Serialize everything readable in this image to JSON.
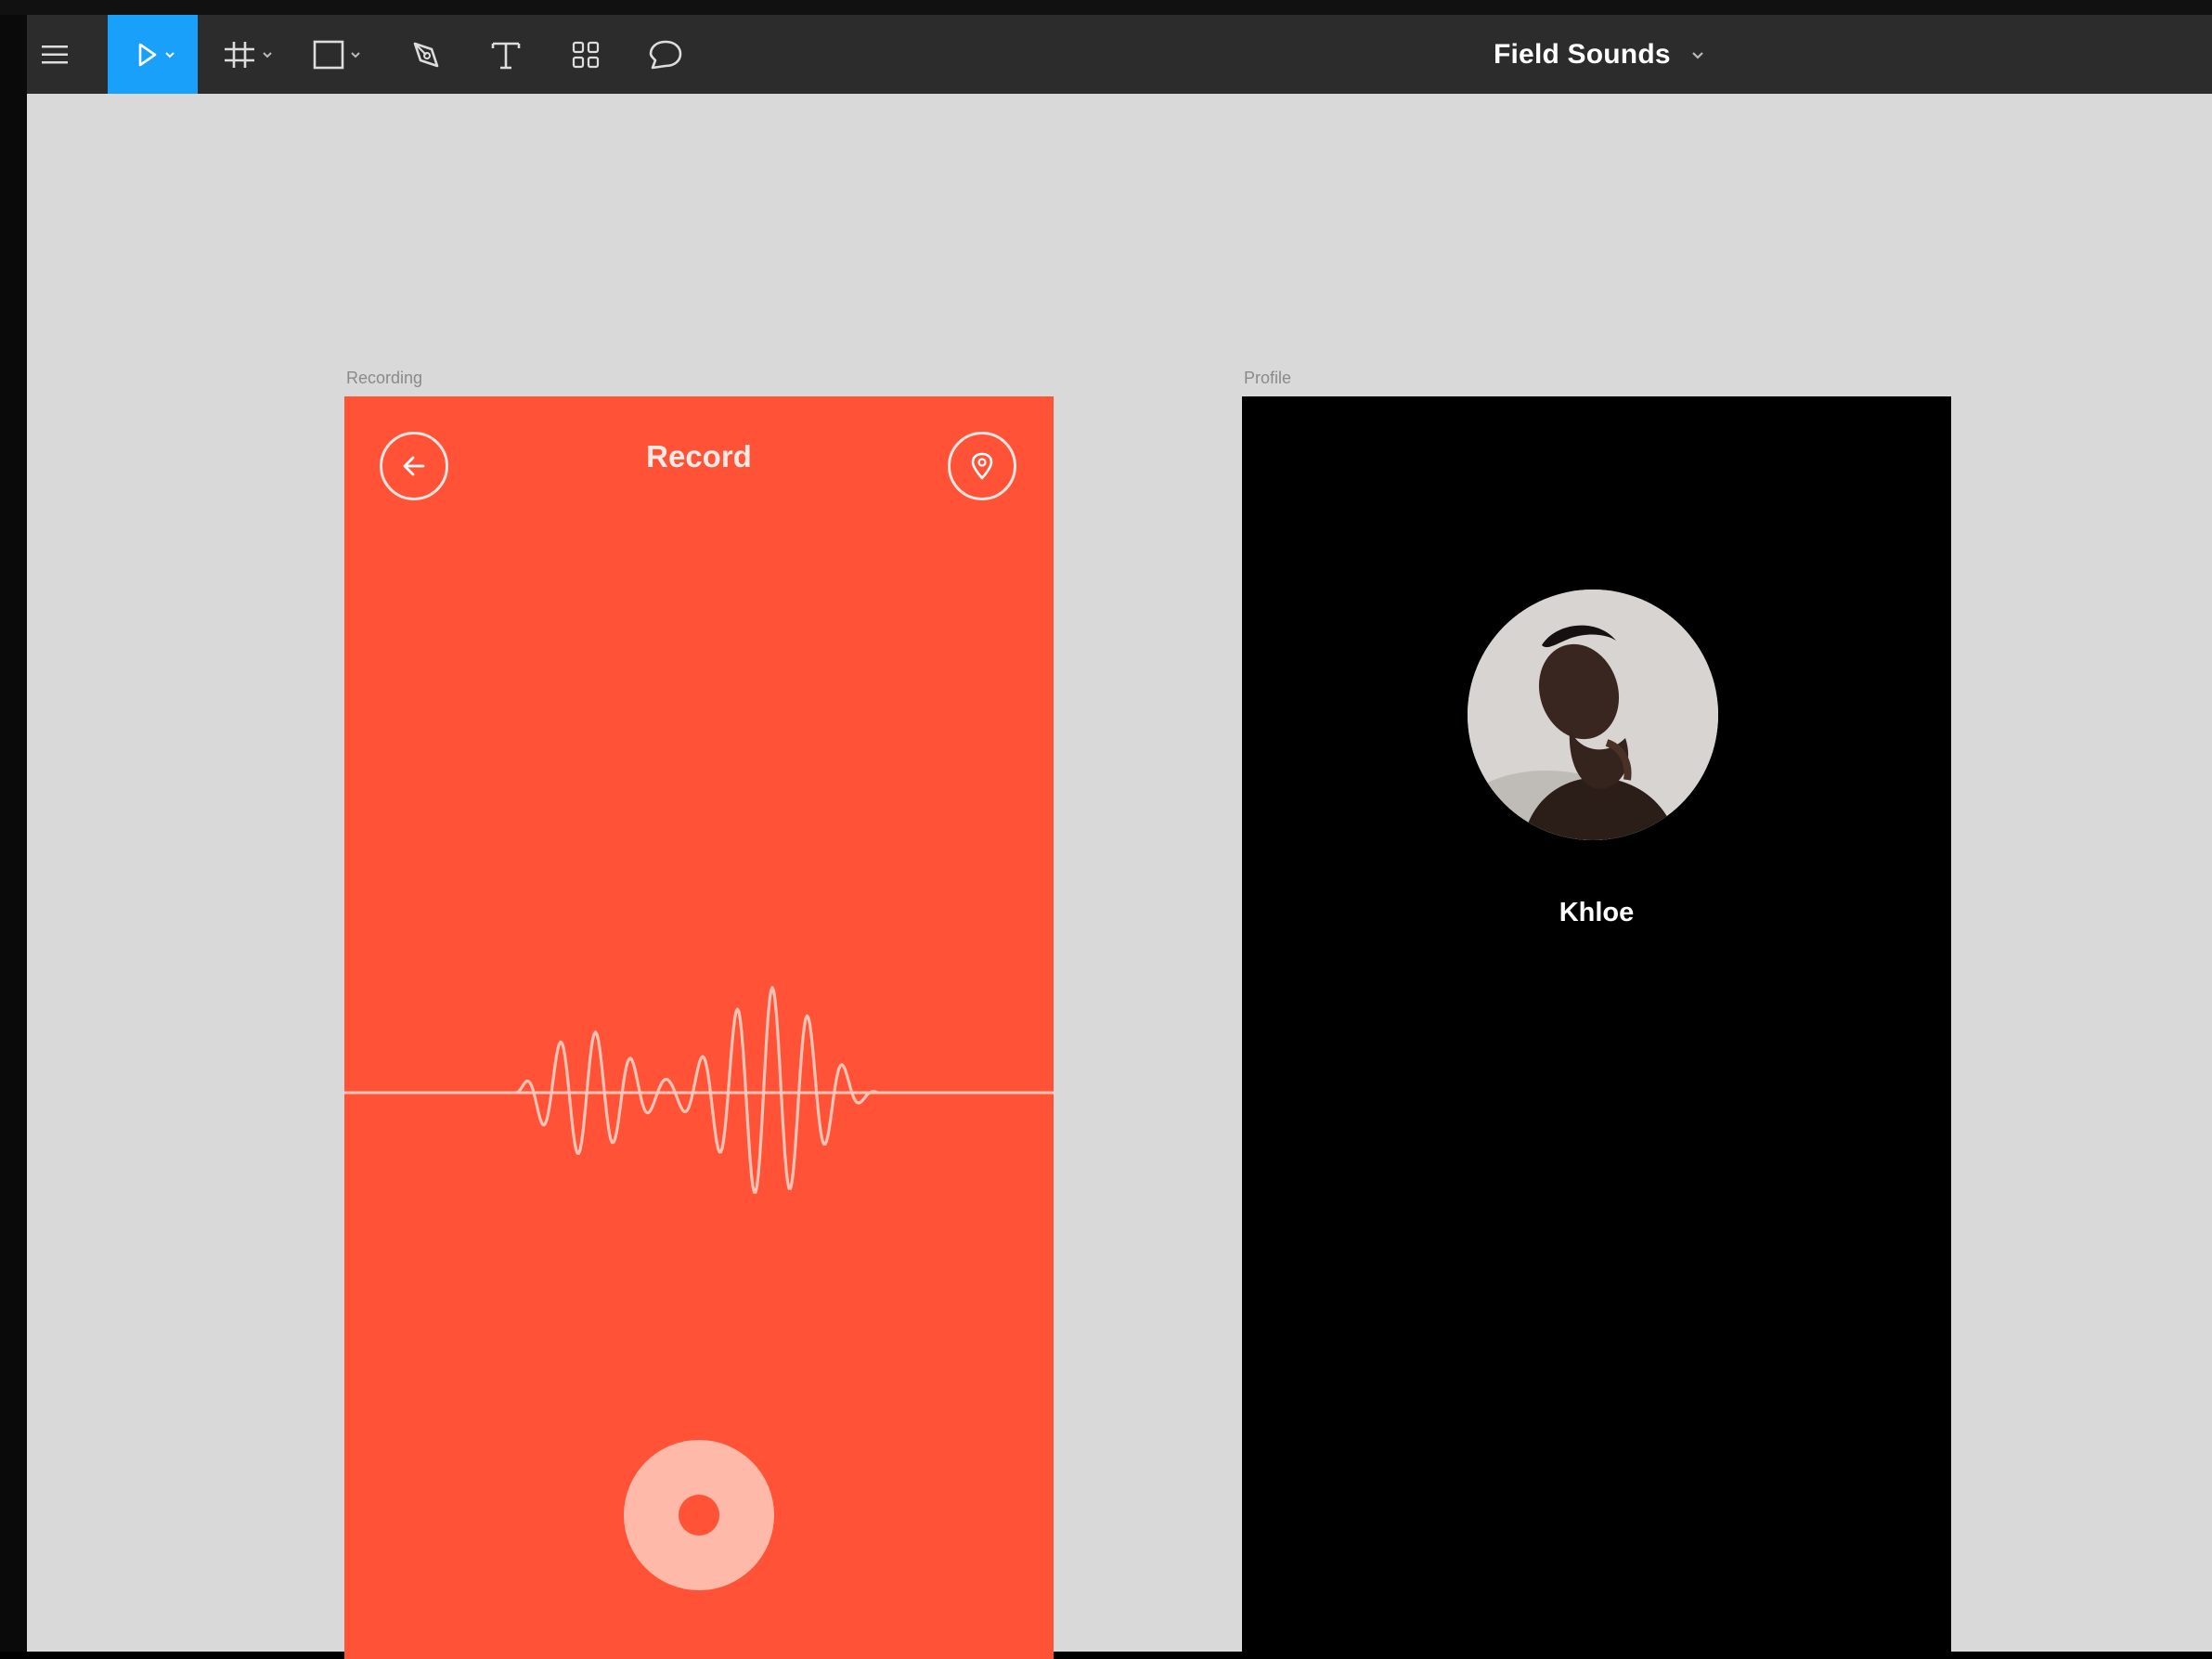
{
  "toolbar": {
    "file_title": "Field Sounds",
    "tools": [
      {
        "name": "menu",
        "icon": "hamburger-menu-icon"
      },
      {
        "name": "move",
        "icon": "move-cursor-icon",
        "active": true
      },
      {
        "name": "frame",
        "icon": "frame-hash-icon"
      },
      {
        "name": "shape",
        "icon": "rectangle-icon"
      },
      {
        "name": "pen",
        "icon": "pen-icon"
      },
      {
        "name": "text",
        "icon": "text-tool-icon"
      },
      {
        "name": "components",
        "icon": "components-grid-icon"
      },
      {
        "name": "comment",
        "icon": "comment-bubble-icon"
      }
    ],
    "active_color": "#18a0fb",
    "bar_color": "#2c2c2c"
  },
  "canvas": {
    "background": "#d9d9d9",
    "frames": {
      "recording": {
        "label": "Recording",
        "title": "Record",
        "background": "#ff5236",
        "icons": [
          "back-arrow-icon",
          "location-pin-icon",
          "record-icon"
        ]
      },
      "profile": {
        "label": "Profile",
        "name": "Khloe",
        "background": "#000000",
        "icons": [
          "avatar"
        ]
      }
    }
  }
}
